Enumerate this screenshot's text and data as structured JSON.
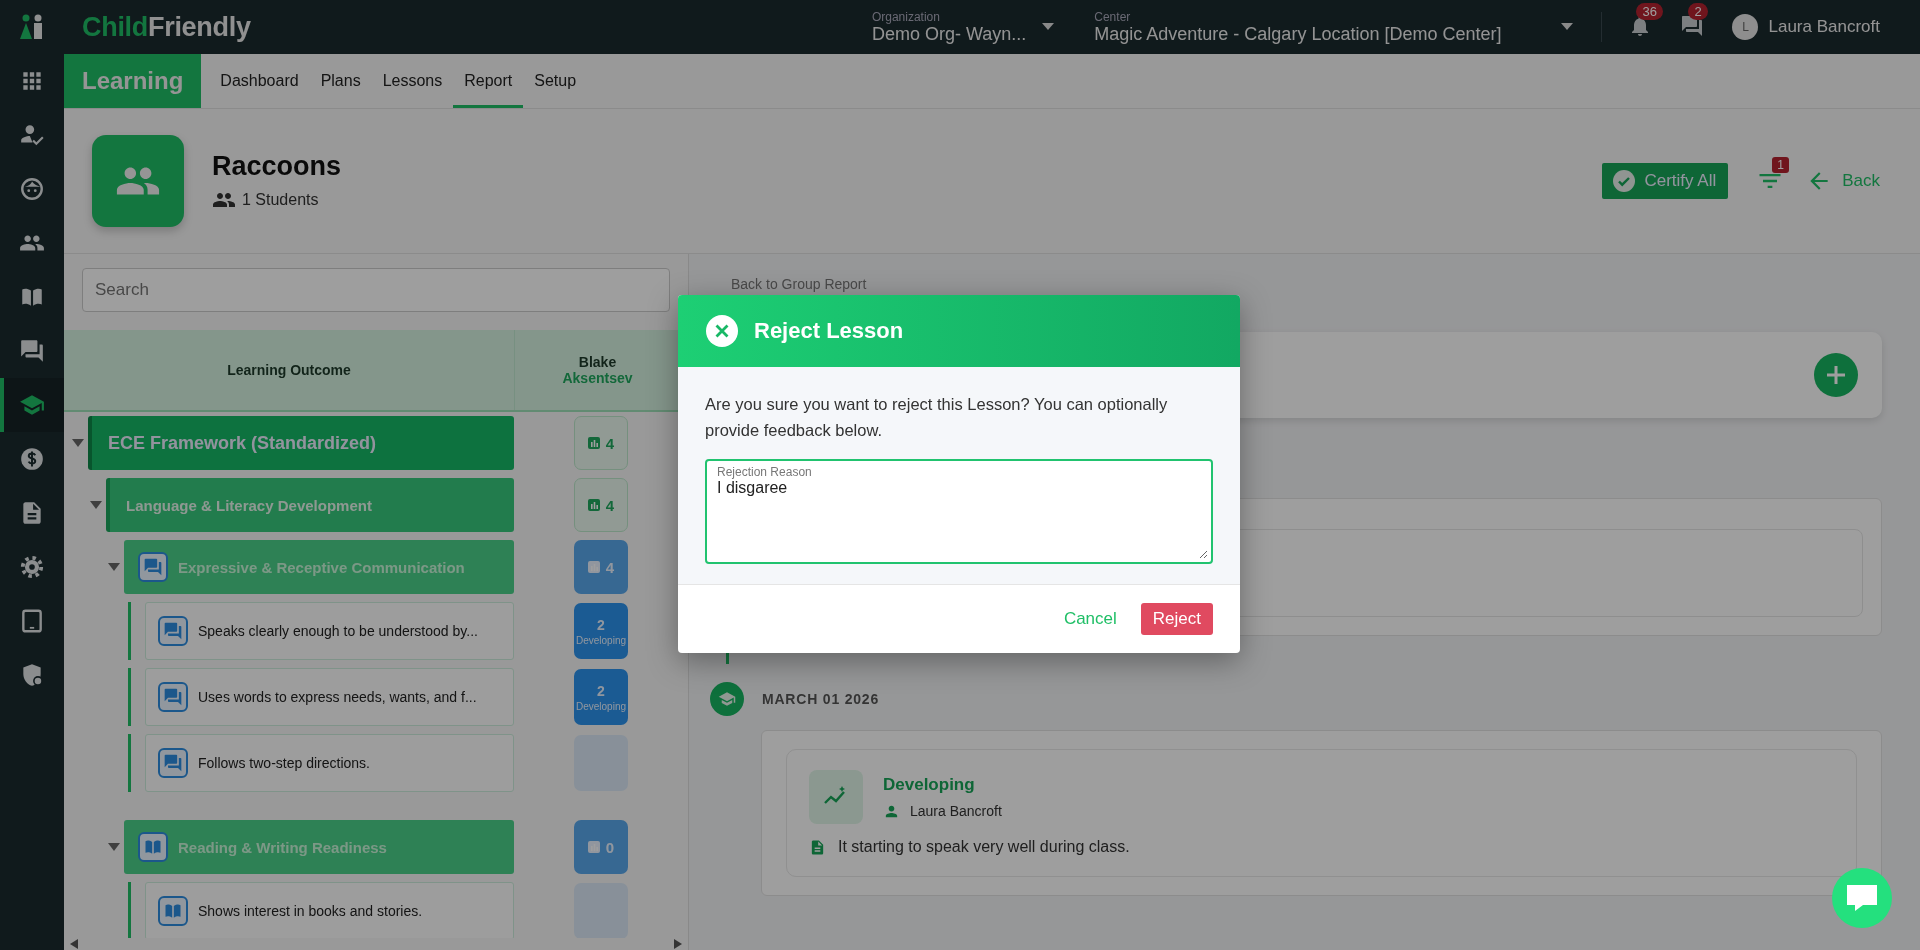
{
  "topbar": {
    "logo": [
      "Child",
      "Friendly"
    ],
    "organization": {
      "label": "Organization",
      "value": "Demo Org- Wayn..."
    },
    "center": {
      "label": "Center",
      "value": "Magic Adventure - Calgary Location [Demo Center]"
    },
    "notifications": "36",
    "messages": "2",
    "user": {
      "initial": "L",
      "name": "Laura Bancroft"
    }
  },
  "sidebar": {
    "items": [
      {
        "kind": "apps",
        "selected": false
      },
      {
        "kind": "attendance",
        "selected": false
      },
      {
        "kind": "child",
        "selected": false
      },
      {
        "kind": "people",
        "selected": false
      },
      {
        "kind": "book",
        "selected": false
      },
      {
        "kind": "chat",
        "selected": false
      },
      {
        "kind": "learning",
        "selected": true
      },
      {
        "kind": "billing",
        "selected": false
      },
      {
        "kind": "document",
        "selected": false
      },
      {
        "kind": "settings",
        "selected": false
      },
      {
        "kind": "tablet",
        "selected": false
      },
      {
        "kind": "security",
        "selected": false
      }
    ]
  },
  "module": "Learning",
  "tabs": [
    {
      "label": "Dashboard",
      "selected": false
    },
    {
      "label": "Plans",
      "selected": false
    },
    {
      "label": "Lessons",
      "selected": false
    },
    {
      "label": "Report",
      "selected": true
    },
    {
      "label": "Setup",
      "selected": false
    }
  ],
  "group": {
    "name": "Raccoons",
    "students": "1 Students"
  },
  "actions": {
    "certify": "Certify All",
    "filter_count": "1",
    "back": "Back"
  },
  "search": {
    "placeholder": "Search"
  },
  "table": {
    "column": "Learning Outcome",
    "student": {
      "first": "Blake",
      "last": "Aksentsev"
    },
    "rows": [
      {
        "kind": "framework",
        "label": "ECE Framework (Standardized)",
        "expanded": true,
        "score": {
          "value": "4"
        },
        "children": [
          {
            "kind": "domain",
            "label": "Language & Literacy Development",
            "expanded": true,
            "score": {
              "value": "4"
            },
            "children": [
              {
                "kind": "group",
                "label": "Expressive & Receptive Communication",
                "expanded": true,
                "score": {
                  "value": "4"
                },
                "children": [
                  {
                    "kind": "indicator",
                    "label": "Speaks clearly enough to be understood by...",
                    "score": {
                      "value": "2",
                      "label": "Developing"
                    }
                  },
                  {
                    "kind": "indicator",
                    "label": "Uses words to express needs, wants, and f...",
                    "score": {
                      "value": "2",
                      "label": "Developing"
                    }
                  },
                  {
                    "kind": "indicator",
                    "label": "Follows two-step directions."
                  }
                ]
              },
              {
                "kind": "group",
                "label": "Reading & Writing Readiness",
                "expanded": true,
                "score": {
                  "value": "0"
                },
                "children": [
                  {
                    "kind": "indicator",
                    "label": "Shows interest in books and stories."
                  }
                ]
              }
            ]
          }
        ]
      }
    ]
  },
  "detail": {
    "back_link": "Back to Group Report",
    "timeline": [
      {
        "date": "MARCH 01 2026",
        "entries": [
          {
            "level": "Developing",
            "author": "Laura Bancroft",
            "note": "It starting to speak very well during class."
          }
        ]
      }
    ]
  },
  "modal": {
    "title": "Reject Lesson",
    "message": "Are you sure you want to reject this Lesson? You can optionally provide feedback below.",
    "field": {
      "label": "Rejection Reason",
      "value": "I disgaree"
    },
    "cancel": "Cancel",
    "confirm": "Reject"
  }
}
